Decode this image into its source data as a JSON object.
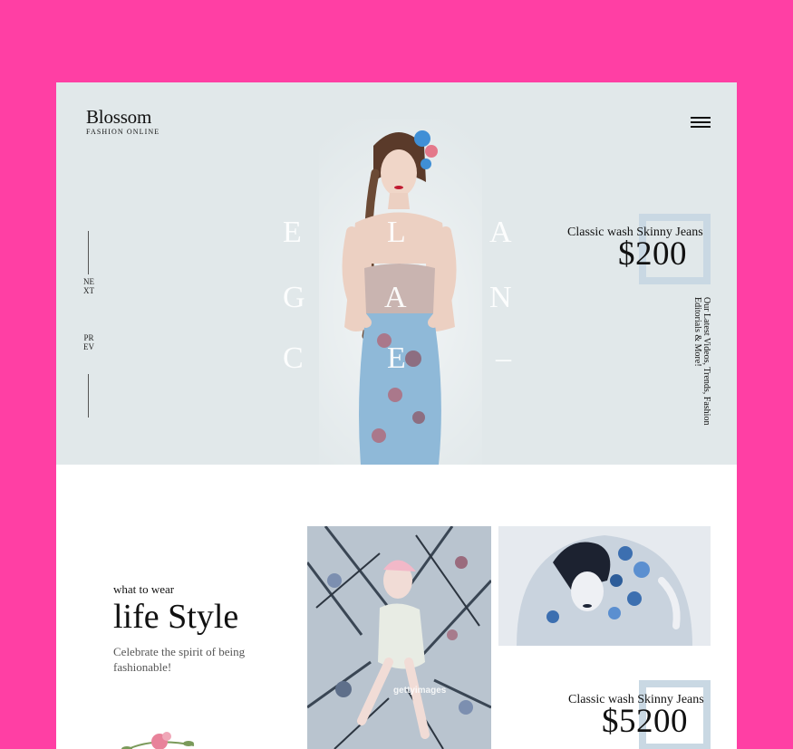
{
  "brand": {
    "name": "Blossom",
    "tagline": "FASHION ONLINE"
  },
  "nav": {
    "next_label": "NEXT",
    "prev_label": "PREV"
  },
  "hero": {
    "letters": [
      "E",
      "L",
      "A",
      "G",
      "A",
      "N",
      "C",
      "E",
      "–"
    ],
    "side_text": "Our Latest Videos, Trends, Fashion Editorials & More!"
  },
  "product1": {
    "title": "Classic wash Skinny Jeans",
    "price": "$200"
  },
  "lifestyle": {
    "kicker": "what to wear",
    "heading": "life Style",
    "description": "Celebrate the spirit of being fashionable!"
  },
  "watermark": "gettyimages",
  "product2": {
    "title": "Classic wash Skinny Jeans",
    "price": "$5200"
  },
  "colors": {
    "frame": "#ff3fa4",
    "hero_bg": "#e1e8ea",
    "accent_box": "#c9d8e3"
  },
  "icons": [
    "menu-icon",
    "flower-icon"
  ]
}
